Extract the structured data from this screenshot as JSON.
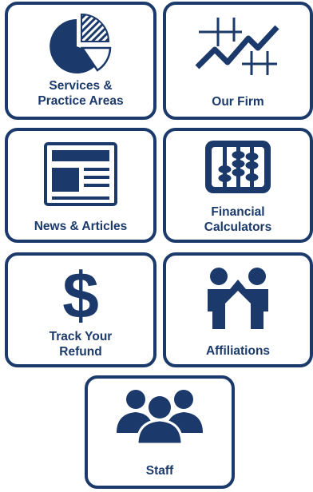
{
  "colors": {
    "primary": "#1b3a6b",
    "background": "#ffffff"
  },
  "tiles": [
    {
      "id": "services",
      "icon": "pie-chart-icon",
      "lines": [
        "Services &",
        "Practice Areas"
      ]
    },
    {
      "id": "our-firm",
      "icon": "line-graph-icon",
      "lines": [
        "Our Firm"
      ]
    },
    {
      "id": "news",
      "icon": "newspaper-icon",
      "lines": [
        "News & Articles"
      ]
    },
    {
      "id": "calculators",
      "icon": "abacus-icon",
      "lines": [
        "Financial",
        "Calculators"
      ]
    },
    {
      "id": "refund",
      "icon": "dollar-sign-icon",
      "lines": [
        "Track Your",
        "Refund"
      ]
    },
    {
      "id": "affiliations",
      "icon": "people-joined-icon",
      "lines": [
        "Affiliations"
      ]
    },
    {
      "id": "staff",
      "icon": "group-icon",
      "lines": [
        "Staff"
      ]
    }
  ]
}
